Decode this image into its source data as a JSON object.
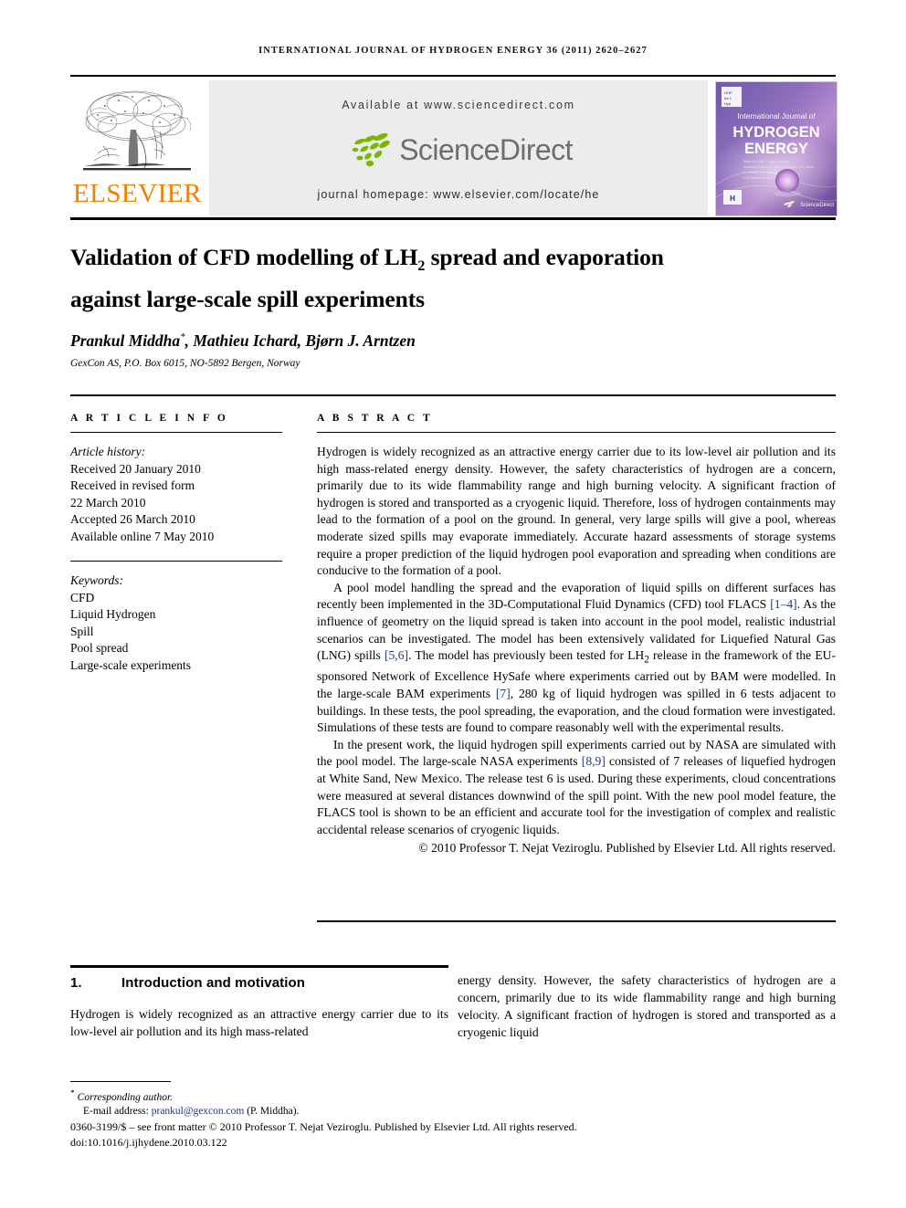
{
  "running_head": "International Journal of Hydrogen Energy 36 (2011) 2620–2627",
  "masthead": {
    "publisher_name": "ELSEVIER",
    "publisher_logo_alt": "elsevier-tree-logo",
    "available_at": "Available at www.sciencedirect.com",
    "sciencedirect_wordmark": "ScienceDirect",
    "journal_homepage": "journal homepage: www.elsevier.com/locate/he",
    "cover": {
      "line1": "International Journal of",
      "line2": "HYDROGEN",
      "line3": "ENERGY",
      "footer_mark": "ScienceDirect"
    },
    "colors": {
      "elsevier_orange": "#F08000",
      "sciencedirect_green": "#7AB800",
      "sciencedirect_gray": "#6E6E6E",
      "band_gray": "#ECECEC"
    }
  },
  "article": {
    "title_line1_a": "Validation of CFD modelling of LH",
    "title_line1_sub": "2",
    "title_line1_b": " spread and evaporation",
    "title_line2": "against large-scale spill experiments",
    "authors": "Prankul Middha",
    "authors_star": "*",
    "authors_rest": ", Mathieu Ichard, Bjørn J. Arntzen",
    "affiliation": "GexCon AS, P.O. Box 6015, NO-5892 Bergen, Norway"
  },
  "article_info": {
    "heading": "A R T I C L E   I N F O",
    "history_label": "Article history:",
    "history": [
      "Received 20 January 2010",
      "Received in revised form",
      "22 March 2010",
      "Accepted 26 March 2010",
      "Available online 7 May 2010"
    ],
    "keywords_label": "Keywords:",
    "keywords": [
      "CFD",
      "Liquid Hydrogen",
      "Spill",
      "Pool spread",
      "Large-scale experiments"
    ]
  },
  "abstract": {
    "heading": "A B S T R A C T",
    "p1": "Hydrogen is widely recognized as an attractive energy carrier due to its low-level air pollution and its high mass-related energy density. However, the safety characteristics of hydrogen are a concern, primarily due to its wide flammability range and high burning velocity. A significant fraction of hydrogen is stored and transported as a cryogenic liquid. Therefore, loss of hydrogen containments may lead to the formation of a pool on the ground. In general, very large spills will give a pool, whereas moderate sized spills may evaporate immediately. Accurate hazard assessments of storage systems require a proper prediction of the liquid hydrogen pool evaporation and spreading when conditions are conducive to the formation of a pool.",
    "p2_a": "A pool model handling the spread and the evaporation of liquid spills on different surfaces has recently been implemented in the 3D-Computational Fluid Dynamics (CFD) tool FLACS ",
    "p2_cite1": "[1–4]",
    "p2_b": ". As the influence of geometry on the liquid spread is taken into account in the pool model, realistic industrial scenarios can be investigated. The model has been extensively validated for Liquefied Natural Gas (LNG) spills ",
    "p2_cite2": "[5,6]",
    "p2_c": ". The model has previously been tested for LH",
    "p2_sub": "2",
    "p2_d": " release in the framework of the EU-sponsored Network of Excellence HySafe where experiments carried out by BAM were modelled. In the large-scale BAM experiments ",
    "p2_cite3": "[7]",
    "p2_e": ", 280 kg of liquid hydrogen was spilled in 6 tests adjacent to buildings. In these tests, the pool spreading, the evaporation, and the cloud formation were investigated. Simulations of these tests are found to compare reasonably well with the experimental results.",
    "p3_a": "In the present work, the liquid hydrogen spill experiments carried out by NASA are simulated with the pool model. The large-scale NASA experiments ",
    "p3_cite1": "[8,9]",
    "p3_b": " consisted of 7 releases of liquefied hydrogen at White Sand, New Mexico. The release test 6 is used. During these experiments, cloud concentrations were measured at several distances downwind of the spill point. With the new pool model feature, the FLACS tool is shown to be an efficient and accurate tool for the investigation of complex and realistic accidental release scenarios of cryogenic liquids.",
    "copyright": "© 2010 Professor T. Nejat Veziroglu. Published by Elsevier Ltd. All rights reserved."
  },
  "body": {
    "section_number": "1.",
    "section_title": "Introduction and motivation",
    "left_column": "Hydrogen is widely recognized as an attractive energy carrier due to its low-level air pollution and its high mass-related",
    "right_column": "energy density. However, the safety characteristics of hydrogen are a concern, primarily due to its wide flammability range and high burning velocity. A significant fraction of hydrogen is stored and transported as a cryogenic liquid"
  },
  "footnote": {
    "star": "*",
    "corresponding": "Corresponding author.",
    "email_label": "E-mail address:",
    "email": "prankul@gexcon.com",
    "email_owner": "(P. Middha).",
    "front_matter": "0360-3199/$ – see front matter © 2010 Professor T. Nejat Veziroglu. Published by Elsevier Ltd. All rights reserved.",
    "doi": "doi:10.1016/j.ijhydene.2010.03.122"
  }
}
